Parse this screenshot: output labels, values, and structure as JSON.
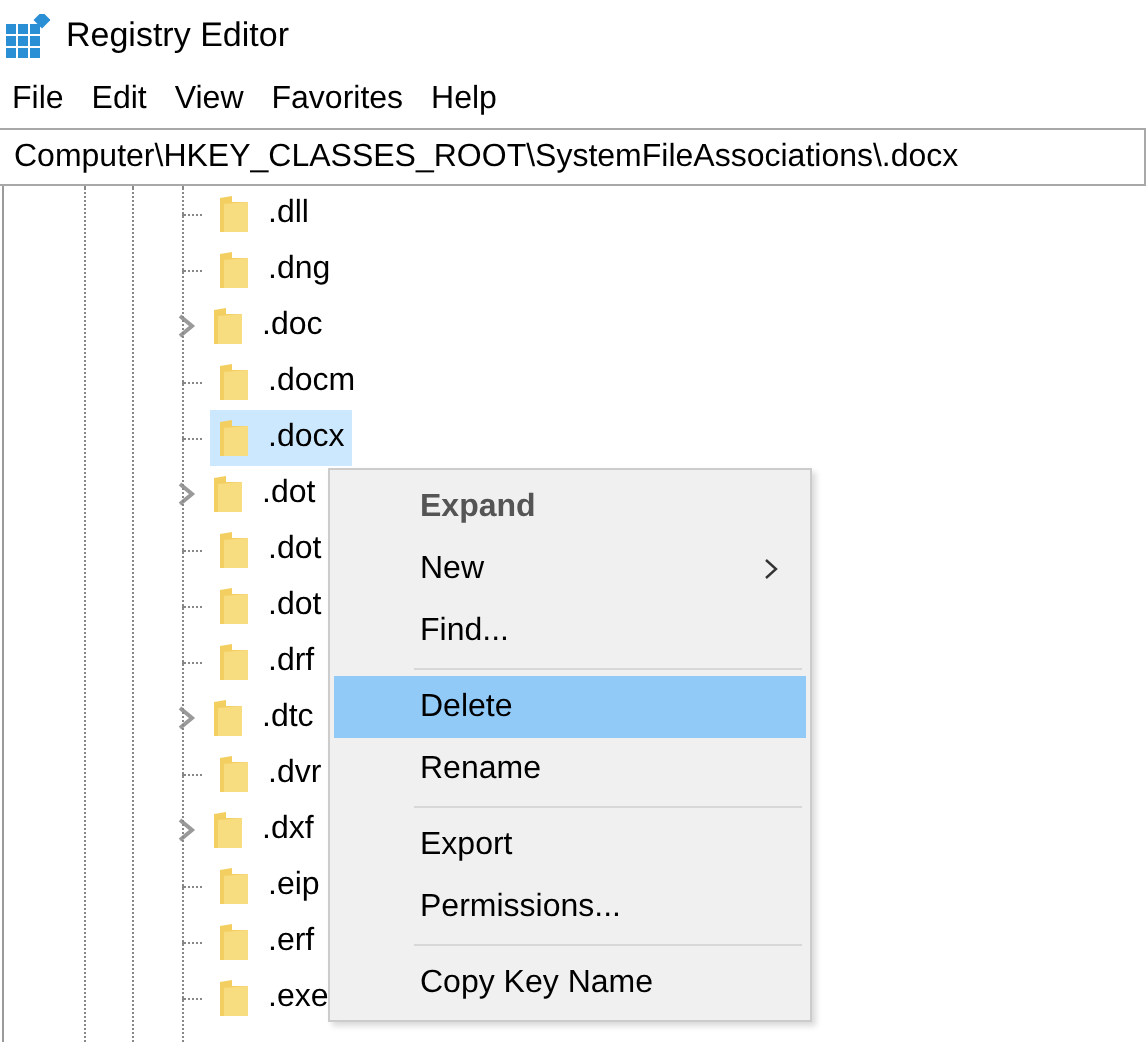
{
  "window": {
    "title": "Registry Editor"
  },
  "menu_bar": [
    "File",
    "Edit",
    "View",
    "Favorites",
    "Help"
  ],
  "address": "Computer\\HKEY_CLASSES_ROOT\\SystemFileAssociations\\.docx",
  "tree": [
    {
      "label": ".dll",
      "has_children": false,
      "selected": false
    },
    {
      "label": ".dng",
      "has_children": false,
      "selected": false
    },
    {
      "label": ".doc",
      "has_children": true,
      "selected": false
    },
    {
      "label": ".docm",
      "has_children": false,
      "selected": false
    },
    {
      "label": ".docx",
      "has_children": false,
      "selected": true
    },
    {
      "label": ".dot",
      "has_children": true,
      "selected": false
    },
    {
      "label": ".dot",
      "has_children": false,
      "selected": false
    },
    {
      "label": ".dot",
      "has_children": false,
      "selected": false
    },
    {
      "label": ".drf",
      "has_children": false,
      "selected": false
    },
    {
      "label": ".dtc",
      "has_children": true,
      "selected": false
    },
    {
      "label": ".dvr",
      "has_children": false,
      "selected": false
    },
    {
      "label": ".dxf",
      "has_children": true,
      "selected": false
    },
    {
      "label": ".eip",
      "has_children": false,
      "selected": false
    },
    {
      "label": ".erf",
      "has_children": false,
      "selected": false
    },
    {
      "label": ".exe",
      "has_children": false,
      "selected": false
    }
  ],
  "context_menu": [
    {
      "kind": "item",
      "label": "Expand",
      "bold": true,
      "submenu": false,
      "selected": false
    },
    {
      "kind": "item",
      "label": "New",
      "bold": false,
      "submenu": true,
      "selected": false
    },
    {
      "kind": "item",
      "label": "Find...",
      "bold": false,
      "submenu": false,
      "selected": false
    },
    {
      "kind": "separator"
    },
    {
      "kind": "item",
      "label": "Delete",
      "bold": false,
      "submenu": false,
      "selected": true
    },
    {
      "kind": "item",
      "label": "Rename",
      "bold": false,
      "submenu": false,
      "selected": false
    },
    {
      "kind": "separator"
    },
    {
      "kind": "item",
      "label": "Export",
      "bold": false,
      "submenu": false,
      "selected": false
    },
    {
      "kind": "item",
      "label": "Permissions...",
      "bold": false,
      "submenu": false,
      "selected": false
    },
    {
      "kind": "separator"
    },
    {
      "kind": "item",
      "label": "Copy Key Name",
      "bold": false,
      "submenu": false,
      "selected": false
    }
  ]
}
